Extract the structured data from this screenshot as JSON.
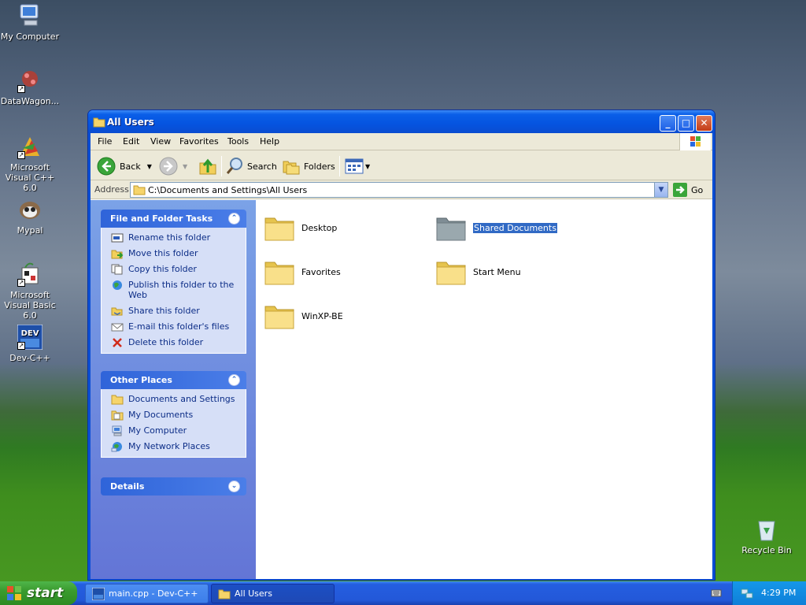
{
  "desktop": {
    "icons": [
      {
        "label": "My Computer",
        "icon": "my-computer-icon"
      },
      {
        "label": "DataWagon...",
        "icon": "datawagon-icon"
      },
      {
        "label": "Microsoft Visual C++ 6.0",
        "icon": "visual-cpp-icon"
      },
      {
        "label": "Mypal",
        "icon": "mypal-icon"
      },
      {
        "label": "Microsoft Visual Basic 6.0",
        "icon": "visual-basic-icon"
      },
      {
        "label": "Dev-C++",
        "icon": "dev-cpp-icon"
      },
      {
        "label": "Recycle Bin",
        "icon": "recycle-bin-icon"
      }
    ]
  },
  "window": {
    "title": "All Users",
    "menu": [
      "File",
      "Edit",
      "View",
      "Favorites",
      "Tools",
      "Help"
    ],
    "toolbar": {
      "back": "Back",
      "search": "Search",
      "folders": "Folders"
    },
    "address": {
      "label": "Address",
      "value": "C:\\Documents and Settings\\All Users",
      "go": "Go"
    },
    "tasks": {
      "title": "File and Folder Tasks",
      "items": [
        "Rename this folder",
        "Move this folder",
        "Copy this folder",
        "Publish this folder to the Web",
        "Share this folder",
        "E-mail this folder's files",
        "Delete this folder"
      ]
    },
    "other_places": {
      "title": "Other Places",
      "items": [
        "Documents and Settings",
        "My Documents",
        "My Computer",
        "My Network Places"
      ]
    },
    "details": {
      "title": "Details"
    },
    "folders": [
      {
        "name": "Desktop",
        "selected": false
      },
      {
        "name": "Shared Documents",
        "selected": true
      },
      {
        "name": "Favorites",
        "selected": false
      },
      {
        "name": "Start Menu",
        "selected": false
      },
      {
        "name": "WinXP-BE",
        "selected": false
      }
    ]
  },
  "taskbar": {
    "start": "start",
    "tasks": [
      {
        "label": "main.cpp - Dev-C++",
        "active": false
      },
      {
        "label": "All Users",
        "active": true
      }
    ],
    "clock": "4:29 PM"
  }
}
